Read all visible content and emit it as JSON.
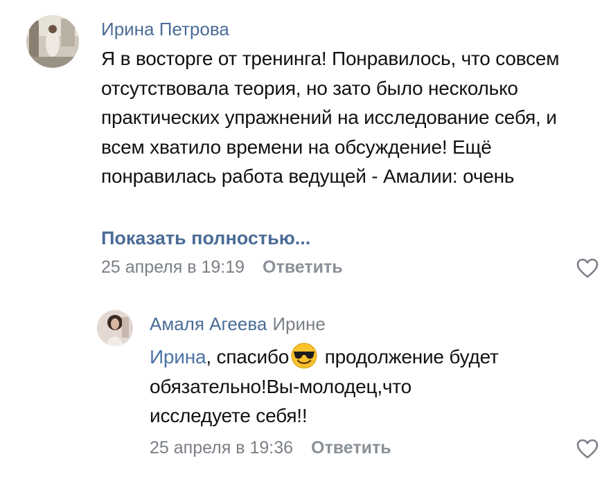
{
  "comments": [
    {
      "author": "Ирина Петрова",
      "text": "Я в восторге от тренинга! Понравилось, что совсем отсутствовала теория, но зато было несколько практических упражнений на исследование себя, и всем хватило времени на обсуждение! Ещё понравилась работа ведущей - Амалии: очень",
      "show_more": "Показать полностью...",
      "date": "25 апреля в 19:19",
      "reply_label": "Ответить",
      "like_icon": "heart-outline-icon"
    },
    {
      "author": "Амаля Агеева",
      "reply_to": "Ирине",
      "mention": "Ирина",
      "text_before_emoji": ", спасибо",
      "emoji": "smiling-face-with-sunglasses",
      "text_after_emoji": " продолжение будет обязательно!Вы-молодец,что исследуете себя!!",
      "date": "25 апреля в 19:36",
      "reply_label": "Ответить",
      "like_icon": "heart-outline-icon"
    }
  ],
  "colors": {
    "author": "#4a6c96",
    "mention": "#4a73a8",
    "meta": "#7a7f86",
    "background": "#ffffff"
  }
}
